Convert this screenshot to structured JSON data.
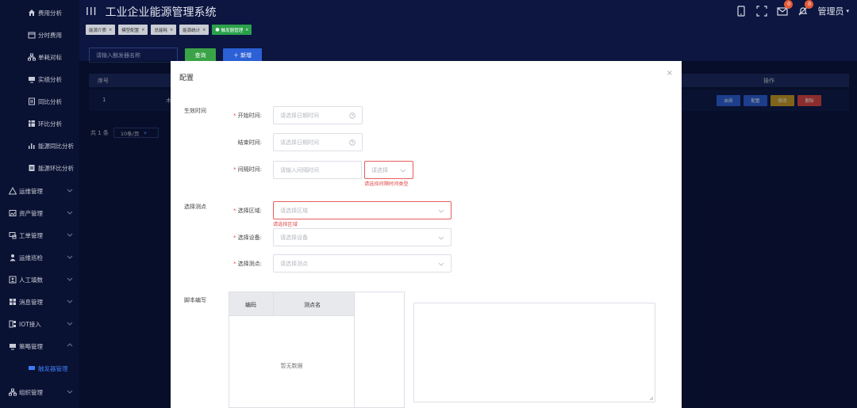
{
  "app": {
    "title": "工业企业能源管理系统",
    "menu_glyph": "III"
  },
  "sidebar": {
    "items": [
      {
        "label": "费用分析",
        "icon": "home-icon"
      },
      {
        "label": "分时费用",
        "icon": "calendar-icon"
      },
      {
        "label": "单耗对标",
        "icon": "org-icon"
      },
      {
        "label": "实绩分析",
        "icon": "monitor-icon"
      },
      {
        "label": "同比分析",
        "icon": "document-icon"
      },
      {
        "label": "环比分析",
        "icon": "table-icon"
      },
      {
        "label": "能源同比分析",
        "icon": "bar-chart-icon"
      },
      {
        "label": "能源环比分析",
        "icon": "document-icon"
      },
      {
        "label": "运维管理",
        "icon": "warning-icon"
      },
      {
        "label": "资产管理",
        "icon": "image-icon"
      },
      {
        "label": "工单管理",
        "icon": "screen-icon"
      },
      {
        "label": "运维巡检",
        "icon": "user-icon"
      },
      {
        "label": "人工填数",
        "icon": "person-card-icon"
      },
      {
        "label": "消息管理",
        "icon": "grid-icon"
      },
      {
        "label": "IOT接入",
        "icon": "iot-icon"
      },
      {
        "label": "策略管理",
        "icon": "monitor-icon"
      },
      {
        "label": "触发器管理",
        "icon": ""
      },
      {
        "label": "组织管理",
        "icon": "org-icon"
      }
    ]
  },
  "header": {
    "user": "管理员",
    "mail_badge": "0",
    "bell_badge": "0"
  },
  "tags": [
    {
      "label": "能源介质"
    },
    {
      "label": "模型配置"
    },
    {
      "label": "总能耗"
    },
    {
      "label": "能源统计"
    },
    {
      "label": "触发器管理"
    }
  ],
  "search": {
    "placeholder": "请输入触发器名称",
    "query_label": "查询",
    "add_label": "＋ 新增"
  },
  "table": {
    "headers": [
      "序号",
      "操作"
    ],
    "rows": [
      {
        "index": "1",
        "partial": "木"
      }
    ],
    "ops": [
      "启用",
      "配置",
      "修改",
      "删除"
    ]
  },
  "pager": {
    "total": "共 1 条",
    "size": "10条/页"
  },
  "modal": {
    "title": "配置",
    "close": "×",
    "sections": {
      "effective": "生效时间",
      "points": "选择测点",
      "script": "脚本编写"
    },
    "start_label": "开始时间:",
    "start_placeholder": "请选择日期时间",
    "end_label": "结束时间:",
    "end_placeholder": "请选择日期时间",
    "interval_label": "间隔时间:",
    "interval_placeholder": "请输入间隔时间",
    "interval_type_placeholder": "请选择",
    "interval_error": "请选择间隔时间类型",
    "area_label": "选择区域:",
    "area_placeholder": "请选择区域",
    "area_error": "请选择区域",
    "device_label": "选择设备:",
    "device_placeholder": "请选择设备",
    "point_label": "选择测点:",
    "point_placeholder": "请选择测点",
    "code_headers": [
      "编码",
      "测点名"
    ],
    "empty_text": "暂无数据"
  },
  "colors": {
    "accent": "#2b60d6",
    "success": "#3aa347",
    "error": "#e04d4d"
  }
}
